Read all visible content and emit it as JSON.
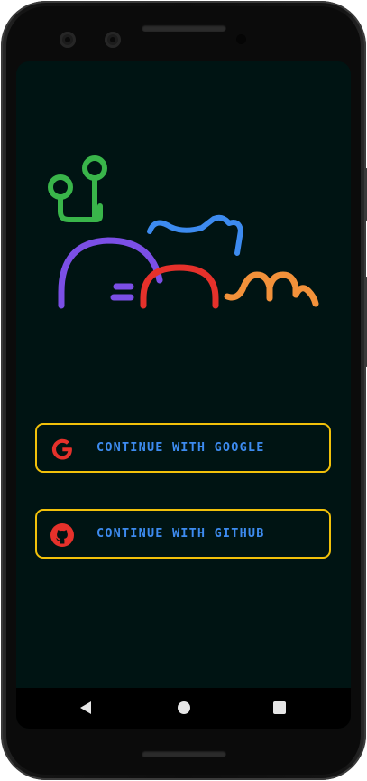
{
  "app": {
    "logo_name": "app-logo-illustration",
    "logo_colors": {
      "green": "#39b54a",
      "purple": "#7b4fe6",
      "blue": "#3d8bef",
      "red": "#e5312b",
      "orange": "#f2913a"
    }
  },
  "auth": {
    "google_label": "CONTINUE WITH GOOGLE",
    "github_label": "CONTINUE WITH GITHUB",
    "border_color": "#f2c10a",
    "label_color": "#3d8bef",
    "icon_color": "#e5312b",
    "google_icon": "google-g-icon",
    "github_icon": "github-octocat-icon"
  },
  "navbar": {
    "back_icon": "back-triangle-icon",
    "home_icon": "home-circle-icon",
    "recents_icon": "recents-square-icon"
  },
  "theme": {
    "screen_bg": "#001413"
  }
}
